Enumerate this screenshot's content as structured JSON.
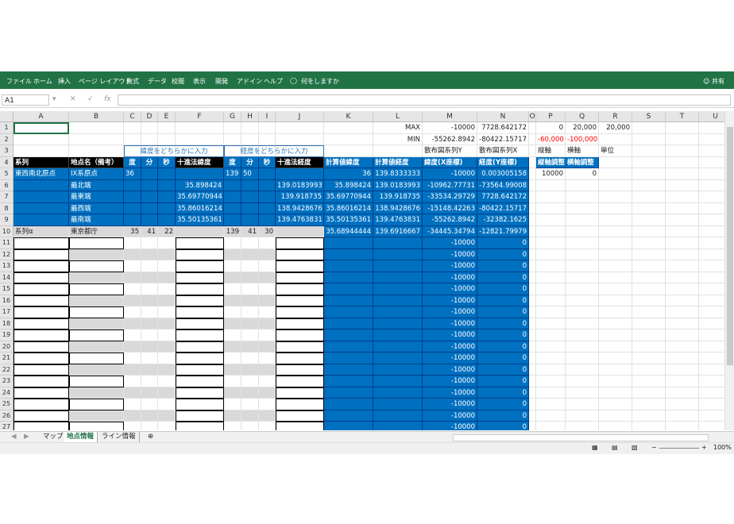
{
  "ribbon": {
    "tabs": [
      "ファイル",
      "ホーム",
      "挿入",
      "ページ レイアウト",
      "数式",
      "データ",
      "校閲",
      "表示",
      "開発",
      "アドイン",
      "ヘルプ"
    ],
    "tell_me": "何をしますか",
    "share": "共有"
  },
  "formula_bar": {
    "name_box": "A1",
    "fx": "fx",
    "value": ""
  },
  "columns": [
    "A",
    "B",
    "C",
    "D",
    "E",
    "F",
    "G",
    "H",
    "I",
    "J",
    "K",
    "L",
    "M",
    "N",
    "O",
    "P",
    "Q",
    "R",
    "S",
    "T",
    "U"
  ],
  "rows": [
    "1",
    "2",
    "3",
    "4",
    "5",
    "6",
    "7",
    "8",
    "9",
    "10",
    "11",
    "12",
    "13",
    "14",
    "15",
    "16",
    "17",
    "18",
    "19",
    "20",
    "21",
    "22",
    "23",
    "24",
    "25",
    "26",
    "27"
  ],
  "notes": {
    "lat": "緯度をどちらかに入力",
    "lon": "経度をどちらかに入力"
  },
  "header": {
    "a": "系列",
    "b": "地点名（備考）",
    "c": "度",
    "d": "分",
    "e": "秒",
    "f": "十進法緯度",
    "g": "度",
    "h": "分",
    "i": "秒",
    "j": "十進法経度",
    "k": "計算値緯度",
    "l": "計算値経度",
    "m": "緯度(X座標)",
    "n": "経度(Y座標)"
  },
  "maxmin": {
    "max_label": "MAX",
    "min_label": "MIN",
    "max_m": "-10000",
    "max_n": "7728.642172",
    "min_m": "-55262.8942",
    "min_n": "-80422.15717",
    "scatter_y": "散布図系列Y",
    "scatter_x": "散布図系列X"
  },
  "settings": {
    "p1": "0",
    "q1": "20,000",
    "r1": "20,000",
    "p2": "-60,000",
    "q2": "-100,000",
    "p3": "縦軸",
    "q3": "横軸",
    "r3": "単位",
    "p4": "縦軸調整",
    "q4": "横軸調整",
    "p5": "10000",
    "q5": "0"
  },
  "data_rows": [
    {
      "a": "東西南北原点",
      "b": "IX系原点",
      "c": "36",
      "d": "",
      "e": "",
      "f": "",
      "g": "139",
      "h": "50",
      "i": "",
      "j": "",
      "k": "36",
      "l": "139.8333333",
      "m": "-10000",
      "n": "0.003005158"
    },
    {
      "a": "",
      "b": "最北端",
      "c": "",
      "d": "",
      "e": "",
      "f": "35.898424",
      "g": "",
      "h": "",
      "i": "",
      "j": "139.0183993",
      "k": "35.898424",
      "l": "139.0183993",
      "m": "-10962.77731",
      "n": "-73564.99008"
    },
    {
      "a": "",
      "b": "最東端",
      "c": "",
      "d": "",
      "e": "",
      "f": "35.69770944",
      "g": "",
      "h": "",
      "i": "",
      "j": "139.918735",
      "k": "35.69770944",
      "l": "139.918735",
      "m": "-33534.29729",
      "n": "7728.642172"
    },
    {
      "a": "",
      "b": "最西端",
      "c": "",
      "d": "",
      "e": "",
      "f": "35.86016214",
      "g": "",
      "h": "",
      "i": "",
      "j": "138.9428676",
      "k": "35.86016214",
      "l": "138.9428676",
      "m": "-15148.42263",
      "n": "-80422.15717"
    },
    {
      "a": "",
      "b": "最南端",
      "c": "",
      "d": "",
      "e": "",
      "f": "35.50135361",
      "g": "",
      "h": "",
      "i": "",
      "j": "139.4763831",
      "k": "35.50135361",
      "l": "139.4763831",
      "m": "-55262.8942",
      "n": "-32382.1625"
    },
    {
      "a": "系列α",
      "b": "東京都庁",
      "c": "35",
      "d": "41",
      "e": "22",
      "f": "",
      "g": "139",
      "h": "41",
      "i": "30",
      "j": "",
      "k": "35.68944444",
      "l": "139.6916667",
      "m": "-34445.34794",
      "n": "-12821.79979"
    }
  ],
  "empty_m": "-10000",
  "empty_n": "0",
  "sheet_tabs": [
    "マップ",
    "地点情報",
    "ライン情報"
  ],
  "zoom": "100%",
  "colors": {
    "blue": "#0070c0",
    "green": "#217346"
  }
}
